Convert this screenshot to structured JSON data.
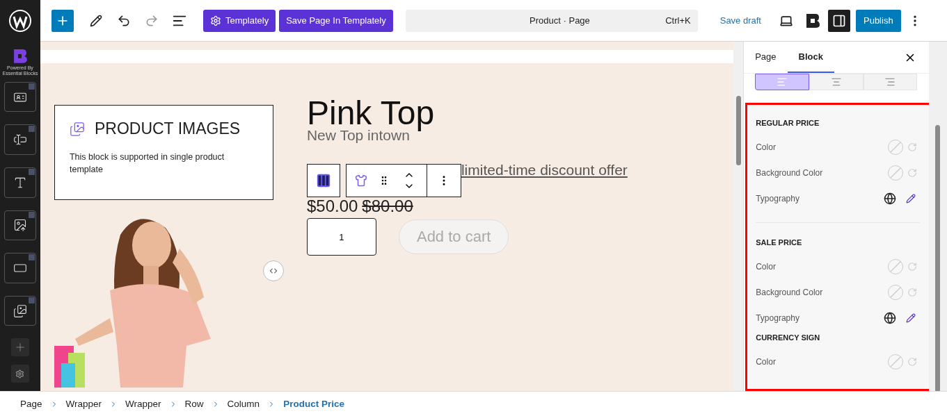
{
  "topbar": {
    "templately_button": "Templately",
    "save_template_button": "Save Page In Templately",
    "command": {
      "title": "Product · Page",
      "shortcut": "Ctrl+K"
    },
    "save_draft": "Save draft",
    "publish": "Publish"
  },
  "sidebar": {
    "brand_caption": "Powered By Essential Blocks"
  },
  "canvas": {
    "product_images": {
      "title": "PRODUCT IMAGES",
      "text": "This block is supported in single product template"
    },
    "product": {
      "title": "Pink Top",
      "subtitle": "New Top intown",
      "link_text": "limited-time discount offer",
      "price": "$50.00",
      "old_price": "$80.00",
      "quantity": "1",
      "add_to_cart": "Add to cart"
    }
  },
  "panel": {
    "tabs": [
      {
        "label": "Page",
        "selected": false
      },
      {
        "label": "Block",
        "selected": true
      }
    ],
    "alignment": [
      {
        "kind": "left",
        "selected": true
      },
      {
        "kind": "center",
        "selected": false
      },
      {
        "kind": "right",
        "selected": false
      }
    ],
    "sections": [
      {
        "title": "REGULAR PRICE",
        "divider": true,
        "rows": [
          {
            "label": "Color",
            "kind": "color"
          },
          {
            "label": "Background Color",
            "kind": "color"
          },
          {
            "label": "Typography",
            "kind": "typography"
          }
        ]
      },
      {
        "title": "SALE PRICE",
        "divider": false,
        "rows": [
          {
            "label": "Color",
            "kind": "color"
          },
          {
            "label": "Background Color",
            "kind": "color"
          },
          {
            "label": "Typography",
            "kind": "typography"
          }
        ]
      },
      {
        "title": "CURRENCY SIGN",
        "divider": false,
        "rows": [
          {
            "label": "Color",
            "kind": "color"
          }
        ]
      }
    ]
  },
  "breadcrumb": [
    {
      "label": "Page",
      "current": false
    },
    {
      "label": "Wrapper",
      "current": false
    },
    {
      "label": "Wrapper",
      "current": false
    },
    {
      "label": "Row",
      "current": false
    },
    {
      "label": "Column",
      "current": false
    },
    {
      "label": "Product Price",
      "current": true
    }
  ]
}
